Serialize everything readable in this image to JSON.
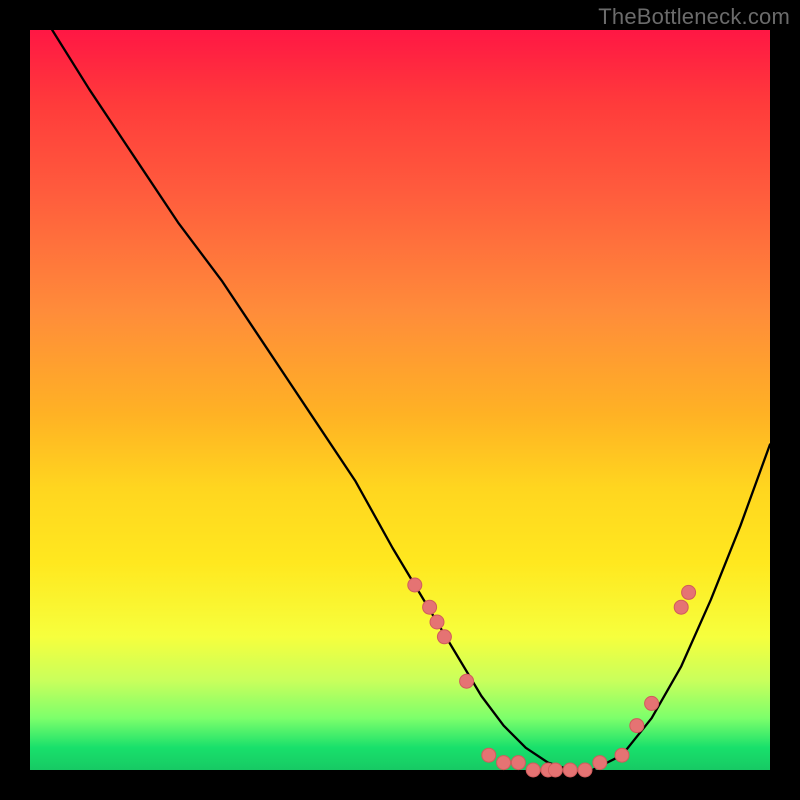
{
  "watermark": "TheBottleneck.com",
  "colors": {
    "background": "#000000",
    "stroke": "#000000",
    "point_fill": "#e57373",
    "point_stroke": "#d05c5c",
    "watermark": "#6b6b6b",
    "gradient_top": "#ff1744",
    "gradient_bottom": "#17c964"
  },
  "chart_data": {
    "type": "line",
    "title": "",
    "xlabel": "",
    "ylabel": "",
    "xlim": [
      0,
      100
    ],
    "ylim": [
      0,
      100
    ],
    "grid": false,
    "legend": false,
    "series": [
      {
        "name": "curve",
        "x": [
          3,
          8,
          14,
          20,
          26,
          32,
          38,
          44,
          49,
          52,
          55,
          58,
          61,
          64,
          67,
          70,
          73,
          76,
          80,
          84,
          88,
          92,
          96,
          100
        ],
        "y": [
          100,
          92,
          83,
          74,
          66,
          57,
          48,
          39,
          30,
          25,
          20,
          15,
          10,
          6,
          3,
          1,
          0,
          0,
          2,
          7,
          14,
          23,
          33,
          44
        ]
      }
    ],
    "points_on_curve": [
      {
        "x": 52,
        "y": 25
      },
      {
        "x": 54,
        "y": 22
      },
      {
        "x": 55,
        "y": 20
      },
      {
        "x": 56,
        "y": 18
      },
      {
        "x": 59,
        "y": 12
      },
      {
        "x": 62,
        "y": 2
      },
      {
        "x": 64,
        "y": 1
      },
      {
        "x": 66,
        "y": 1
      },
      {
        "x": 68,
        "y": 0
      },
      {
        "x": 70,
        "y": 0
      },
      {
        "x": 71,
        "y": 0
      },
      {
        "x": 73,
        "y": 0
      },
      {
        "x": 75,
        "y": 0
      },
      {
        "x": 77,
        "y": 1
      },
      {
        "x": 80,
        "y": 2
      },
      {
        "x": 82,
        "y": 6
      },
      {
        "x": 84,
        "y": 9
      },
      {
        "x": 88,
        "y": 22
      },
      {
        "x": 89,
        "y": 24
      }
    ]
  }
}
